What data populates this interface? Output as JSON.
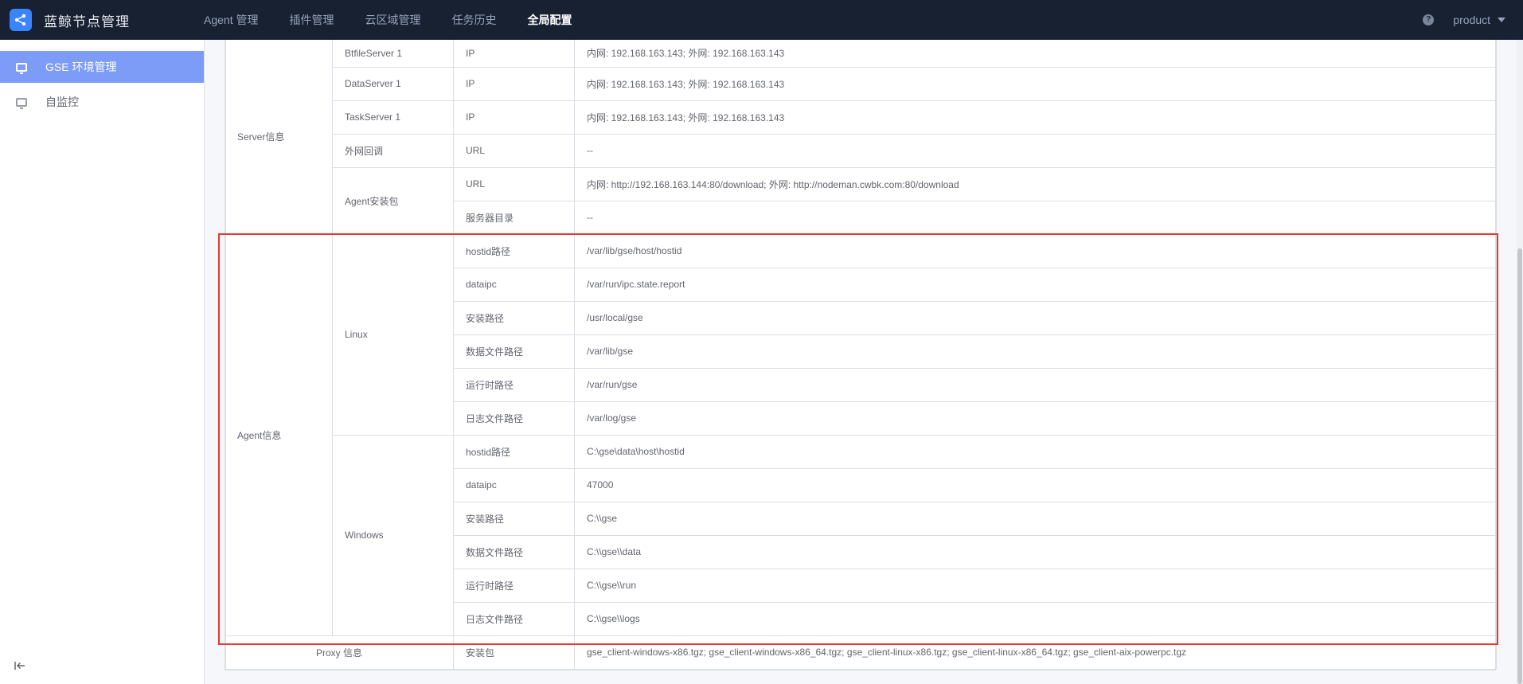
{
  "header": {
    "app_title": "蓝鲸节点管理",
    "nav": [
      {
        "label": "Agent 管理",
        "active": false
      },
      {
        "label": "插件管理",
        "active": false
      },
      {
        "label": "云区域管理",
        "active": false
      },
      {
        "label": "任务历史",
        "active": false
      },
      {
        "label": "全局配置",
        "active": true
      }
    ],
    "user": "product"
  },
  "sidebar": {
    "items": [
      {
        "label": "GSE 环境管理",
        "icon": "monitor-icon",
        "active": true
      },
      {
        "label": "自监控",
        "icon": "monitor-icon",
        "active": false
      }
    ],
    "collapse_icon": "collapse-icon"
  },
  "table": {
    "server": {
      "label": "Server信息",
      "rows": [
        {
          "name": "BtfileServer 1",
          "key": "IP",
          "value": "内网: 192.168.163.143; 外网: 192.168.163.143"
        },
        {
          "name": "DataServer 1",
          "key": "IP",
          "value": "内网: 192.168.163.143; 外网: 192.168.163.143"
        },
        {
          "name": "TaskServer 1",
          "key": "IP",
          "value": "内网: 192.168.163.143; 外网: 192.168.163.143"
        },
        {
          "name": "外网回调",
          "key": "URL",
          "value": "--"
        }
      ],
      "package": {
        "name": "Agent安装包",
        "rows": [
          {
            "key": "URL",
            "value": "内网: http://192.168.163.144:80/download; 外网: http://nodeman.cwbk.com:80/download"
          },
          {
            "key": "服务器目录",
            "value": "--"
          }
        ]
      }
    },
    "agent": {
      "label": "Agent信息",
      "linux": {
        "name": "Linux",
        "rows": [
          {
            "key": "hostid路径",
            "value": "/var/lib/gse/host/hostid"
          },
          {
            "key": "dataipc",
            "value": "/var/run/ipc.state.report"
          },
          {
            "key": "安装路径",
            "value": "/usr/local/gse"
          },
          {
            "key": "数据文件路径",
            "value": "/var/lib/gse"
          },
          {
            "key": "运行时路径",
            "value": "/var/run/gse"
          },
          {
            "key": "日志文件路径",
            "value": "/var/log/gse"
          }
        ]
      },
      "windows": {
        "name": "Windows",
        "rows": [
          {
            "key": "hostid路径",
            "value": "C:\\gse\\data\\host\\hostid"
          },
          {
            "key": "dataipc",
            "value": "47000"
          },
          {
            "key": "安装路径",
            "value": "C:\\\\gse"
          },
          {
            "key": "数据文件路径",
            "value": "C:\\\\gse\\\\data"
          },
          {
            "key": "运行时路径",
            "value": "C:\\\\gse\\\\run"
          },
          {
            "key": "日志文件路径",
            "value": "C:\\\\gse\\\\logs"
          }
        ]
      }
    },
    "proxy": {
      "label": "Proxy 信息",
      "key": "安装包",
      "value": "gse_client-windows-x86.tgz; gse_client-windows-x86_64.tgz; gse_client-linux-x86.tgz; gse_client-linux-x86_64.tgz; gse_client-aix-powerpc.tgz"
    }
  },
  "colors": {
    "header_bg": "#182132",
    "accent": "#3a84ff",
    "highlight": "#ea3636"
  }
}
